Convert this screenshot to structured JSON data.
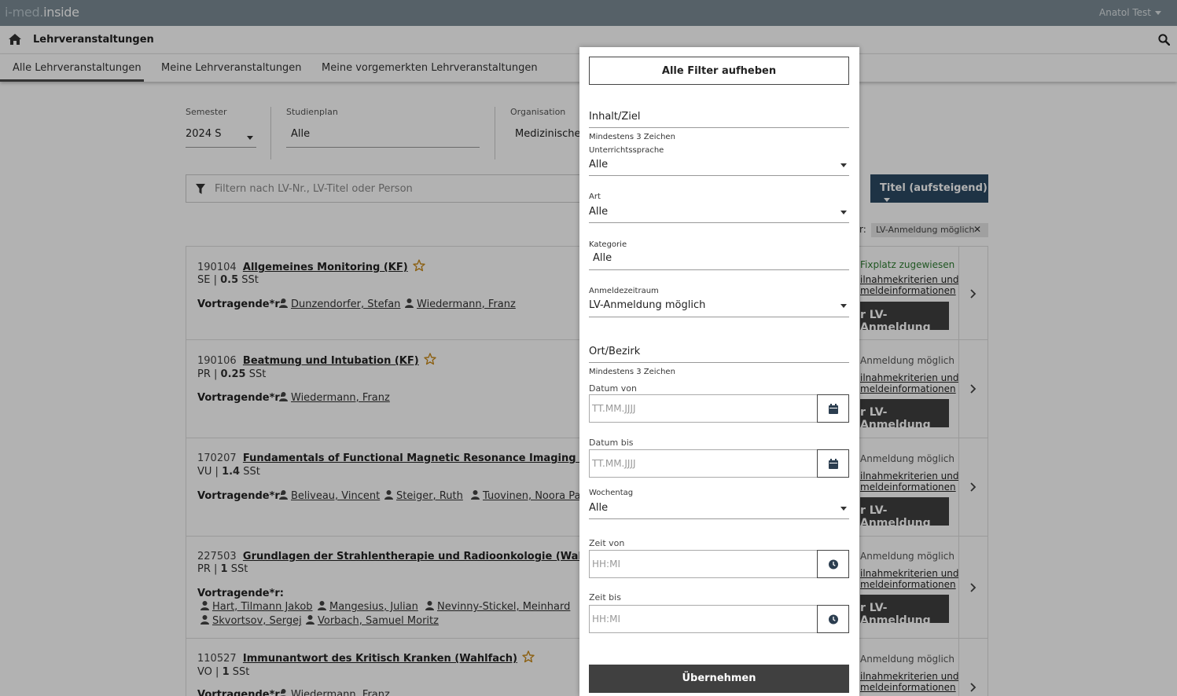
{
  "app": {
    "logo_prefix": "i-med.",
    "logo_brand": "inside",
    "user": "Anatol Test"
  },
  "breadcrumb": {
    "title": "Lehrveranstaltungen"
  },
  "tabs": [
    {
      "label": "Alle Lehrveranstaltungen",
      "active": true
    },
    {
      "label": "Meine Lehrveranstaltungen",
      "active": false
    },
    {
      "label": "Meine vorgemerkten Lehrveranstaltungen",
      "active": false
    }
  ],
  "filters": {
    "semester": {
      "label": "Semester",
      "value": "2024 S"
    },
    "studienplan": {
      "label": "Studienplan",
      "value": "Alle"
    },
    "organisation": {
      "label": "Organisation",
      "value": "Medizinische"
    }
  },
  "search": {
    "placeholder": "Filtern nach LV-Nr., LV-Titel oder Person"
  },
  "sort": {
    "label": "Titel (aufsteigend)"
  },
  "active_filter": {
    "prefix": "r:",
    "chip": "LV-Anmeldung möglich",
    "remove": "✕"
  },
  "courses": [
    {
      "code": "190104",
      "title": "Allgemeines Monitoring (KF)",
      "type": "SE",
      "hours": "0.5",
      "unit": "SSt",
      "lecturers_label": "Vortragende*r:",
      "lecturers": [
        "Dunzendorfer, Stefan",
        "Wiedermann, Franz"
      ],
      "status": "Fixplatz zugewiesen",
      "status_color": "#2e7d32",
      "info_line1": "ilnahmekriterien und",
      "info_line2": "meldeinformationen",
      "register": "r LV-Anmeldung"
    },
    {
      "code": "190106",
      "title": "Beatmung und Intubation (KF)",
      "type": "PR",
      "hours": "0.25",
      "unit": "SSt",
      "lecturers_label": "Vortragende*r:",
      "lecturers": [
        "Wiedermann, Franz"
      ],
      "status": "Anmeldung möglich",
      "info_line1": "ilnahmekriterien und",
      "info_line2": "meldeinformationen",
      "register": "r LV-Anmeldung"
    },
    {
      "code": "170207",
      "title": "Fundamentals of Functional Magnetic Resonance Imaging (fMRI) (KF)",
      "type": "VU",
      "hours": "1.4",
      "unit": "SSt",
      "lecturers_label": "Vortragende*r:",
      "lecturers": [
        "Beliveau, Vincent",
        "Steiger, Ruth",
        "Tuovinen, Noora Pau"
      ],
      "status": "Anmeldung möglich",
      "info_line1": "ilnahmekriterien und",
      "info_line2": "meldeinformationen",
      "register": "r LV-Anmeldung"
    },
    {
      "code": "227503",
      "title": "Grundlagen der Strahlentherapie und Radioonkologie (Wahlfach)",
      "type": "PR",
      "hours": "1",
      "unit": "SSt",
      "lecturers_label": "Vortragende*r:",
      "lecturers": [
        "Hart, Tilmann Jakob",
        "Mangesius, Julian",
        "Nevinny-Stickel, Meinhard",
        "Skvortsov, Sergej",
        "Vorbach, Samuel Moritz"
      ],
      "status": "Anmeldung möglich",
      "info_line1": "ilnahmekriterien und",
      "info_line2": "meldeinformationen",
      "register": "r LV-Anmeldung"
    },
    {
      "code": "110527",
      "title": "Immunantwort des Kritisch Kranken (Wahlfach)",
      "type": "VO",
      "hours": "1",
      "unit": "SSt",
      "lecturers_label": "Vortragende*r:",
      "lecturers": [
        "Wiedermann, Franz"
      ],
      "status": "Anmeldung möglich",
      "info_line1": "ilnahmekriterien und",
      "info_line2": "meldeinformationen",
      "register": ""
    }
  ],
  "panel": {
    "clear_all": "Alle Filter aufheben",
    "inhalt": {
      "label": "Inhalt/Ziel",
      "hint": "Mindestens 3 Zeichen"
    },
    "sprache": {
      "label": "Unterrichtssprache",
      "value": "Alle"
    },
    "art": {
      "label": "Art",
      "value": "Alle"
    },
    "kategorie": {
      "label": "Kategorie",
      "value": "Alle"
    },
    "anmeldezeitraum": {
      "label": "Anmeldezeitraum",
      "value": "LV-Anmeldung möglich"
    },
    "ort": {
      "label": "Ort/Bezirk",
      "hint": "Mindestens 3 Zeichen"
    },
    "datum_von": {
      "label": "Datum von",
      "placeholder": "TT.MM.JJJJ"
    },
    "datum_bis": {
      "label": "Datum bis",
      "placeholder": "TT.MM.JJJJ"
    },
    "wochentag": {
      "label": "Wochentag",
      "value": "Alle"
    },
    "zeit_von": {
      "label": "Zeit von",
      "placeholder": "HH:MI"
    },
    "zeit_bis": {
      "label": "Zeit bis",
      "placeholder": "HH:MI"
    },
    "apply": "Übernehmen"
  },
  "colors": {
    "topbar": "#7b8c96",
    "sort_button": "#2c4a63",
    "dark_button": "#404040",
    "star": "#c98a1a",
    "status_green": "#2e7d32"
  },
  "icons": [
    "home-icon",
    "search-icon",
    "filter-icon",
    "star-icon",
    "user-icon",
    "chevron-right-icon",
    "calendar-icon",
    "clock-icon",
    "close-icon",
    "caret-down-icon"
  ]
}
